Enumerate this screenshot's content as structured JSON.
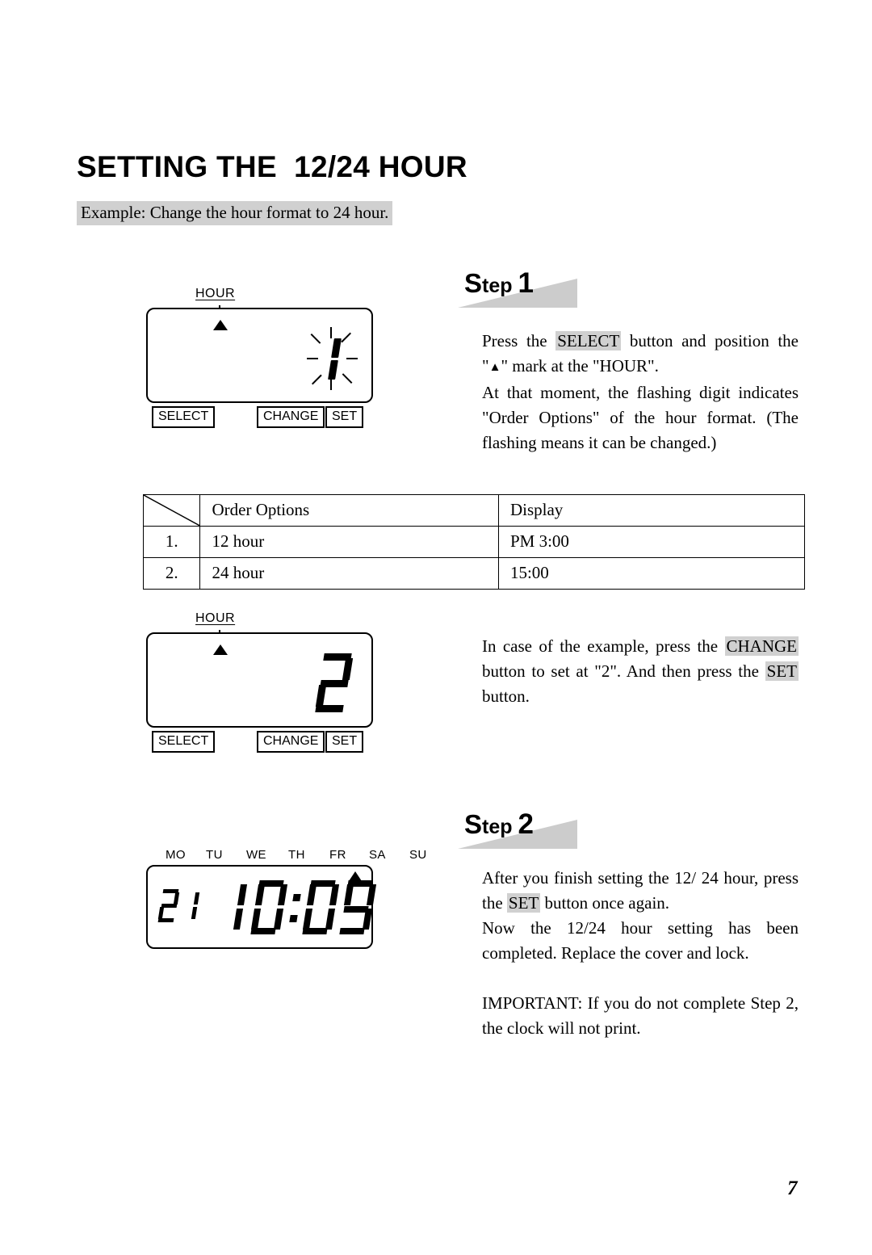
{
  "page": {
    "title": "SETTING THE  12/24 HOUR",
    "example": "Example: Change the hour format to 24 hour.",
    "page_number": "7"
  },
  "steps": [
    {
      "banner_prefix": "S",
      "banner_mid": "tep",
      "banner_number": "1",
      "paragraphs": [
        {
          "segments": [
            {
              "text": "Press the ",
              "style": "plain"
            },
            {
              "text": "SELECT",
              "style": "highlight"
            },
            {
              "text": " button and position the \"",
              "style": "plain"
            },
            {
              "text": "▲",
              "style": "triangle"
            },
            {
              "text": "\" mark at the \"HOUR\".",
              "style": "plain"
            }
          ]
        },
        {
          "segments": [
            {
              "text": "At that moment, the flashing digit indicates \"Order Options\" of the hour format. (The flashing means it can be changed.)",
              "style": "plain"
            }
          ]
        }
      ]
    },
    {
      "banner_prefix": "S",
      "banner_mid": "tep",
      "banner_number": "2",
      "paragraphs": [
        {
          "segments": [
            {
              "text": "After you finish setting the 12/ 24 hour, press the ",
              "style": "plain"
            },
            {
              "text": "SET",
              "style": "highlight"
            },
            {
              "text": " button once again.",
              "style": "plain"
            }
          ]
        },
        {
          "segments": [
            {
              "text": "Now the 12/24 hour setting has been completed. Replace the cover and lock.",
              "style": "plain"
            }
          ]
        },
        {
          "segments": [
            {
              "text": "IMPORTANT: If you do not complete Step 2, the clock will not print.",
              "style": "plain"
            }
          ]
        }
      ]
    }
  ],
  "middle_note": {
    "segments": [
      {
        "text": "In case of the example, press the ",
        "style": "plain"
      },
      {
        "text": "CHANGE",
        "style": "highlight"
      },
      {
        "text": " button to set at \"2\". And then press the ",
        "style": "plain"
      },
      {
        "text": "SET",
        "style": "highlight"
      },
      {
        "text": " button.",
        "style": "plain"
      }
    ]
  },
  "devices": {
    "first": {
      "hour_label": "HOUR",
      "digit": "1",
      "flashing": true,
      "buttons": [
        "SELECT",
        "CHANGE",
        "SET"
      ]
    },
    "second": {
      "hour_label": "HOUR",
      "digit": "2",
      "flashing": false,
      "buttons": [
        "SELECT",
        "CHANGE",
        "SET"
      ]
    },
    "third": {
      "day_labels": [
        "MO",
        "TU",
        "WE",
        "TH",
        "FR",
        "SA",
        "SU"
      ],
      "active_day": "SU",
      "date_digits": "21",
      "time_digits": "10:09"
    }
  },
  "table": {
    "headers": [
      "",
      "Order Options",
      "Display"
    ],
    "rows": [
      {
        "num": "1.",
        "option": "12 hour",
        "display": "PM 3:00"
      },
      {
        "num": "2.",
        "option": "24 hour",
        "display": "15:00"
      }
    ]
  },
  "colors": {
    "highlight": "#d0d0d0",
    "ink": "#000000",
    "paper": "#ffffff"
  }
}
